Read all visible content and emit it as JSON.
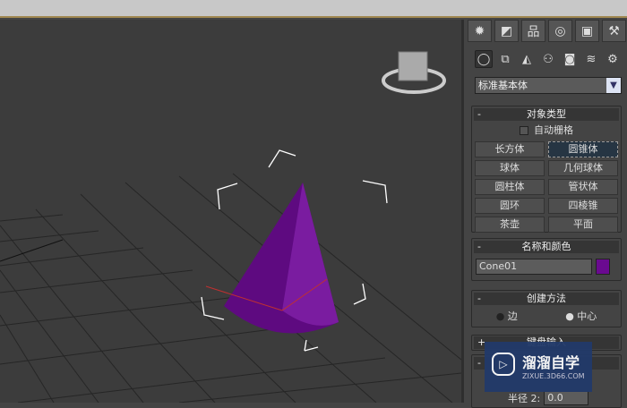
{
  "panel": {
    "tabs": [
      "create",
      "modify",
      "hierarchy",
      "motion",
      "display",
      "utilities"
    ],
    "subcategories": [
      "geometry",
      "shapes",
      "lights",
      "cameras",
      "helpers",
      "space-warps",
      "systems"
    ],
    "category_dropdown": "标准基本体",
    "object_type": {
      "title": "对象类型",
      "autogrid": "自动栅格",
      "buttons": [
        "长方体",
        "圆锥体",
        "球体",
        "几何球体",
        "圆柱体",
        "管状体",
        "圆环",
        "四棱锥",
        "茶壶",
        "平面"
      ],
      "selected": "圆锥体"
    },
    "name_color": {
      "title": "名称和颜色",
      "name": "Cone01",
      "color": "#6a0a90"
    },
    "creation_method": {
      "title": "创建方法",
      "options": [
        "边",
        "中心"
      ],
      "selected": "中心"
    },
    "keyboard_entry": {
      "title": "键盘输入"
    },
    "params": {
      "radius2_label": "半径 2:",
      "radius2_value": "0.0"
    }
  },
  "watermark": {
    "brand": "溜溜自学",
    "url": "ZIXUE.3D66.COM"
  }
}
